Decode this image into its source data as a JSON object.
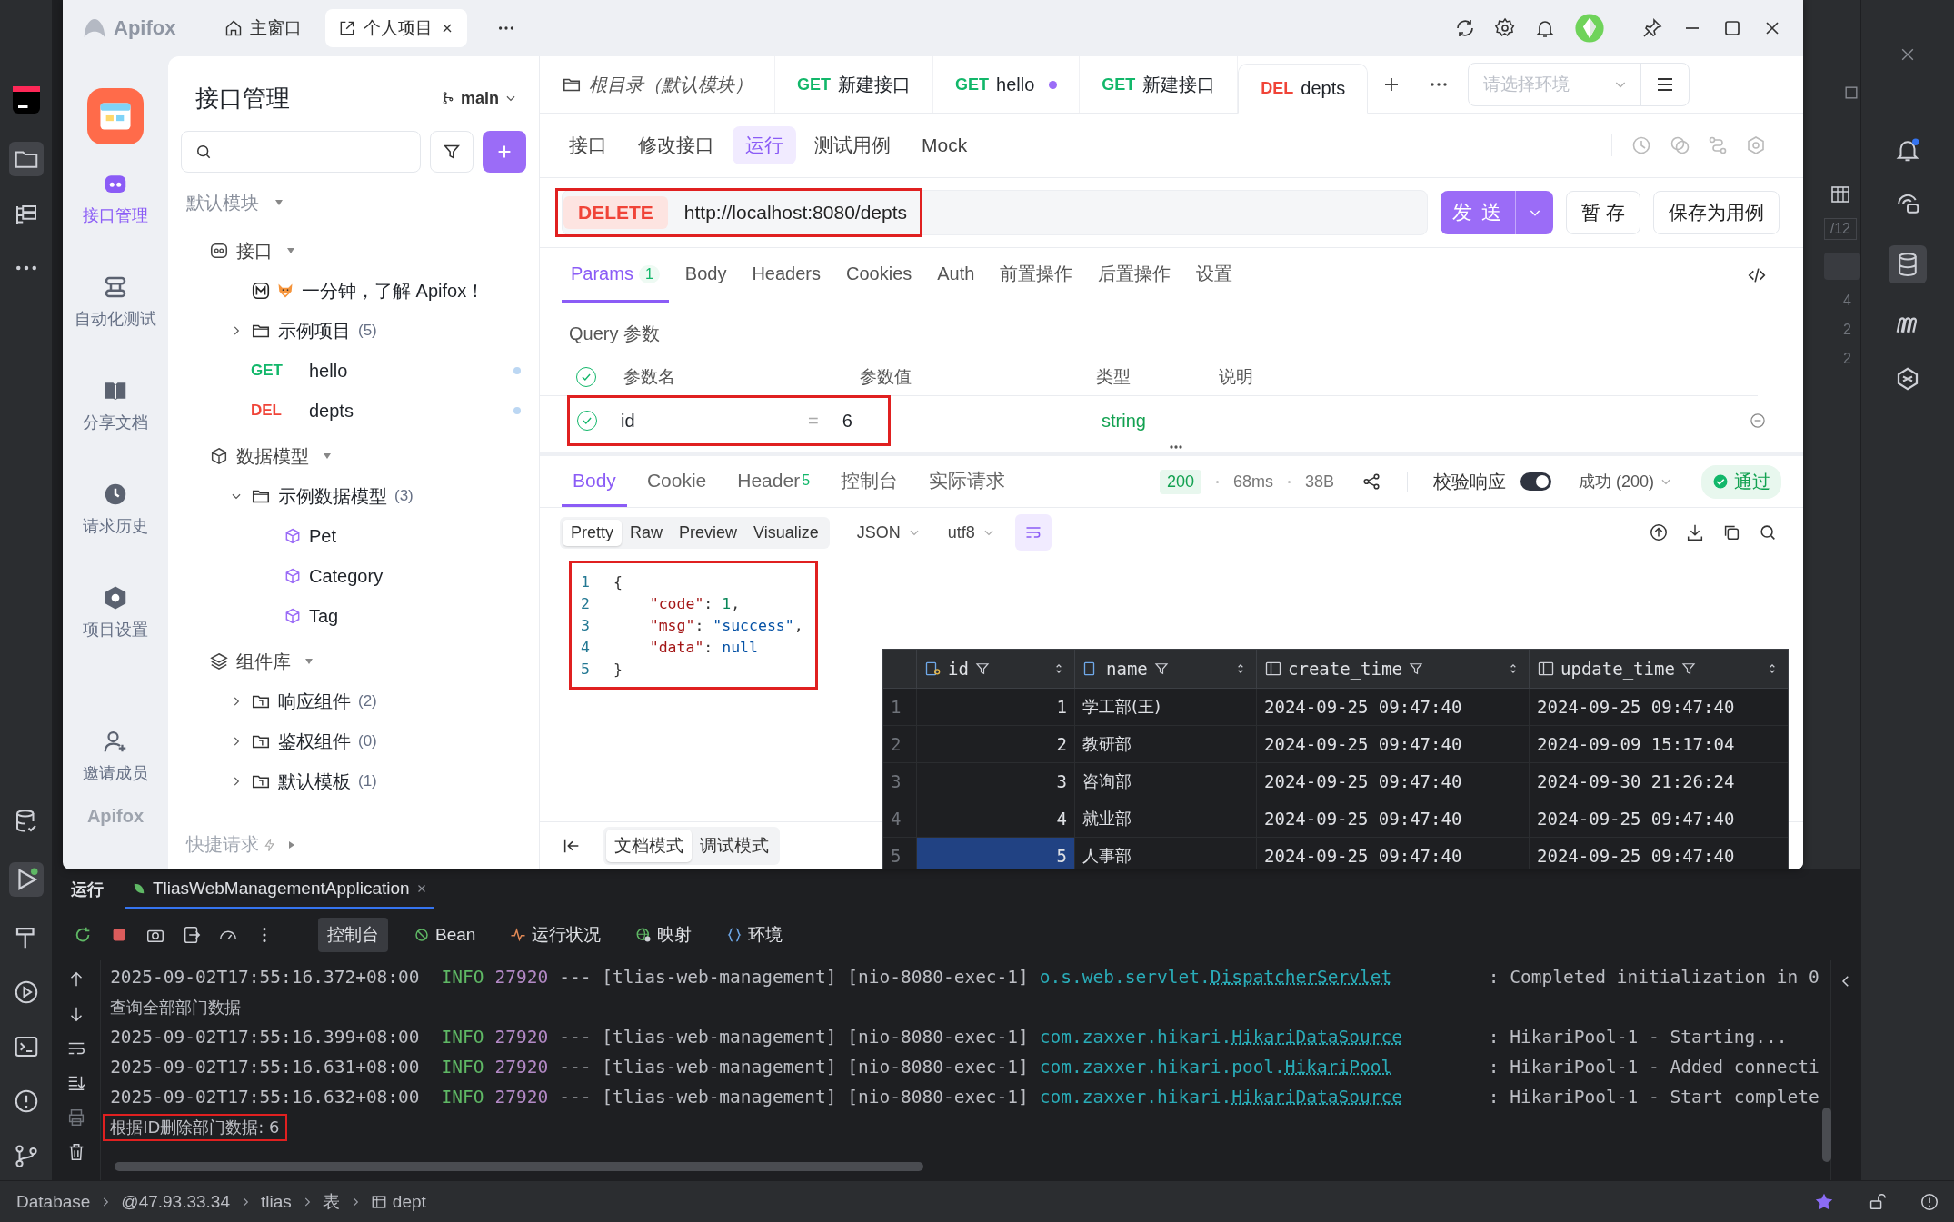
{
  "apifox": {
    "brand": "Apifox",
    "window_tabs": [
      {
        "label": "主窗口",
        "selected": false
      },
      {
        "label": "个人项目",
        "selected": true
      }
    ],
    "rail": [
      {
        "label": "接口管理",
        "selected": true
      },
      {
        "label": "自动化测试",
        "selected": false
      },
      {
        "label": "分享文档",
        "selected": false
      },
      {
        "label": "请求历史",
        "selected": false
      },
      {
        "label": "项目设置",
        "selected": false
      },
      {
        "label": "邀请成员",
        "selected": false
      }
    ],
    "rail_footer": "Apifox",
    "nav": {
      "title": "接口管理",
      "branch": "main",
      "module": "默认模块",
      "quick": "快捷请求",
      "tree": [
        {
          "kind": "section",
          "label": "接口",
          "expanded": true,
          "children": [
            {
              "kind": "doc",
              "label": "一分钟，了解 Apifox！"
            },
            {
              "kind": "folder",
              "label": "示例项目",
              "count": "(5)",
              "expanded": false
            },
            {
              "kind": "endpoint",
              "method": "GET",
              "label": "hello"
            },
            {
              "kind": "endpoint",
              "method": "DEL",
              "label": "depts"
            }
          ]
        },
        {
          "kind": "section",
          "label": "数据模型",
          "expanded": true,
          "children": [
            {
              "kind": "folder",
              "label": "示例数据模型",
              "count": "(3)",
              "expanded": true,
              "children": [
                {
                  "kind": "model",
                  "label": "Pet"
                },
                {
                  "kind": "model",
                  "label": "Category"
                },
                {
                  "kind": "model",
                  "label": "Tag"
                }
              ]
            }
          ]
        },
        {
          "kind": "section",
          "label": "组件库",
          "expanded": true,
          "children": [
            {
              "kind": "component",
              "label": "响应组件",
              "count": "(2)",
              "expanded": false
            },
            {
              "kind": "component",
              "label": "鉴权组件",
              "count": "(0)",
              "expanded": false
            },
            {
              "kind": "component",
              "label": "默认模板",
              "count": "(1)",
              "expanded": false
            }
          ]
        }
      ]
    },
    "doc_tabs": [
      {
        "kind": "folder",
        "label": "根目录（默认模块）",
        "selected": false,
        "unsaved": false
      },
      {
        "kind": "endpoint",
        "method": "GET",
        "label": "新建接口",
        "selected": false,
        "unsaved": false
      },
      {
        "kind": "endpoint",
        "method": "GET",
        "label": "hello",
        "selected": false,
        "unsaved": true
      },
      {
        "kind": "endpoint",
        "method": "GET",
        "label": "新建接口",
        "selected": false,
        "unsaved": false
      },
      {
        "kind": "endpoint",
        "method": "DEL",
        "label": "depts",
        "selected": true,
        "unsaved": false
      }
    ],
    "env": {
      "placeholder": "请选择环境"
    },
    "sub_tabs": [
      {
        "label": "接口",
        "selected": false
      },
      {
        "label": "修改接口",
        "selected": false
      },
      {
        "label": "运行",
        "selected": true
      },
      {
        "label": "测试用例",
        "selected": false
      },
      {
        "label": "Mock",
        "selected": false
      }
    ],
    "request": {
      "method": "DELETE",
      "url": "http://localhost:8080/depts",
      "highlighted": true,
      "send": "发 送",
      "save": "暂 存",
      "save_case": "保存为用例"
    },
    "param_tabs": [
      {
        "label": "Params",
        "badge": "1",
        "selected": true
      },
      {
        "label": "Body",
        "selected": false
      },
      {
        "label": "Headers",
        "selected": false
      },
      {
        "label": "Cookies",
        "selected": false
      },
      {
        "label": "Auth",
        "selected": false
      },
      {
        "label": "前置操作",
        "selected": false
      },
      {
        "label": "后置操作",
        "selected": false
      },
      {
        "label": "设置",
        "selected": false
      }
    ],
    "query": {
      "title": "Query 参数",
      "header_checked": true,
      "columns": [
        "参数名",
        "参数值",
        "类型",
        "说明"
      ],
      "rows": [
        {
          "checked": true,
          "name": "id",
          "operator": "=",
          "value": "6",
          "type": "string",
          "highlighted": true
        }
      ]
    },
    "response": {
      "tabs": [
        {
          "label": "Body",
          "selected": true
        },
        {
          "label": "Cookie",
          "selected": false
        },
        {
          "label": "Header",
          "badge": "5",
          "selected": false
        },
        {
          "label": "控制台",
          "selected": false
        },
        {
          "label": "实际请求",
          "selected": false
        }
      ],
      "status": "200",
      "time": "68ms",
      "size": "38B",
      "validate": {
        "label": "校验响应",
        "on": true
      },
      "result": "成功 (200)",
      "verdict": "通过",
      "formats": [
        {
          "label": "Pretty",
          "selected": true
        },
        {
          "label": "Raw",
          "selected": false
        },
        {
          "label": "Preview",
          "selected": false
        },
        {
          "label": "Visualize",
          "selected": false
        }
      ],
      "content_type": "JSON",
      "encoding": "utf8",
      "highlighted": true,
      "code": [
        {
          "n": "1",
          "text": "{"
        },
        {
          "n": "2",
          "text": "    \"code\": 1,"
        },
        {
          "n": "3",
          "text": "    \"msg\": \"success\","
        },
        {
          "n": "4",
          "text": "    \"data\": null"
        },
        {
          "n": "5",
          "text": "}"
        }
      ]
    },
    "modes": [
      {
        "label": "文档模式",
        "selected": true
      },
      {
        "label": "调试模式",
        "selected": false
      }
    ]
  },
  "db_table": {
    "columns": [
      "id",
      "name",
      "create_time",
      "update_time"
    ],
    "rows": [
      {
        "n": "1",
        "cells": [
          "1",
          "学工部(王)",
          "2024-09-25 09:47:40",
          "2024-09-25 09:47:40"
        ],
        "selected": false
      },
      {
        "n": "2",
        "cells": [
          "2",
          "教研部",
          "2024-09-25 09:47:40",
          "2024-09-09 15:17:04"
        ],
        "selected": false
      },
      {
        "n": "3",
        "cells": [
          "3",
          "咨询部",
          "2024-09-25 09:47:40",
          "2024-09-30 21:26:24"
        ],
        "selected": false
      },
      {
        "n": "4",
        "cells": [
          "4",
          "就业部",
          "2024-09-25 09:47:40",
          "2024-09-25 09:47:40"
        ],
        "selected": false
      },
      {
        "n": "5",
        "cells": [
          "5",
          "人事部",
          "2024-09-25 09:47:40",
          "2024-09-25 09:47:40"
        ],
        "selected": true
      }
    ]
  },
  "ide": {
    "side_fragments": [
      "/12",
      "4",
      "2",
      "2"
    ],
    "run": {
      "title": "运行",
      "tabs": [
        {
          "label": "TliasWebManagementApplication",
          "selected": true
        }
      ],
      "tools": [
        {
          "label": "控制台",
          "selected": true
        },
        {
          "label": "Bean",
          "selected": false
        },
        {
          "label": "运行状况",
          "selected": false
        },
        {
          "label": "映射",
          "selected": false
        },
        {
          "label": "环境",
          "selected": false
        }
      ],
      "console": [
        {
          "kind": "log",
          "time": "2025-09-02T17:55:16.372+08:00",
          "level": "INFO",
          "pid": "27920",
          "thread": "--- [tlias-web-management] [nio-8080-exec-1]",
          "logger_package": "o.s.web.servlet.",
          "logger_class": "DispatcherServlet",
          "message": ": Completed initialization in 0"
        },
        {
          "kind": "plain",
          "text": "查询全部部门数据",
          "highlighted": false
        },
        {
          "kind": "log",
          "time": "2025-09-02T17:55:16.399+08:00",
          "level": "INFO",
          "pid": "27920",
          "thread": "--- [tlias-web-management] [nio-8080-exec-1]",
          "logger_package": "com.zaxxer.hikari.",
          "logger_class": "HikariDataSource",
          "message": ": HikariPool-1 - Starting..."
        },
        {
          "kind": "log",
          "time": "2025-09-02T17:55:16.631+08:00",
          "level": "INFO",
          "pid": "27920",
          "thread": "--- [tlias-web-management] [nio-8080-exec-1]",
          "logger_package": "com.zaxxer.hikari.pool.",
          "logger_class": "HikariPool",
          "message": ": HikariPool-1 - Added connecti"
        },
        {
          "kind": "log",
          "time": "2025-09-02T17:55:16.632+08:00",
          "level": "INFO",
          "pid": "27920",
          "thread": "--- [tlias-web-management] [nio-8080-exec-1]",
          "logger_package": "com.zaxxer.hikari.",
          "logger_class": "HikariDataSource",
          "message": ": HikariPool-1 - Start complete"
        },
        {
          "kind": "plain",
          "text": "根据ID删除部门数据: 6",
          "highlighted": true
        }
      ]
    },
    "status_bar": [
      "Database",
      "@47.93.33.34",
      "tlias",
      "表",
      "dept"
    ]
  }
}
